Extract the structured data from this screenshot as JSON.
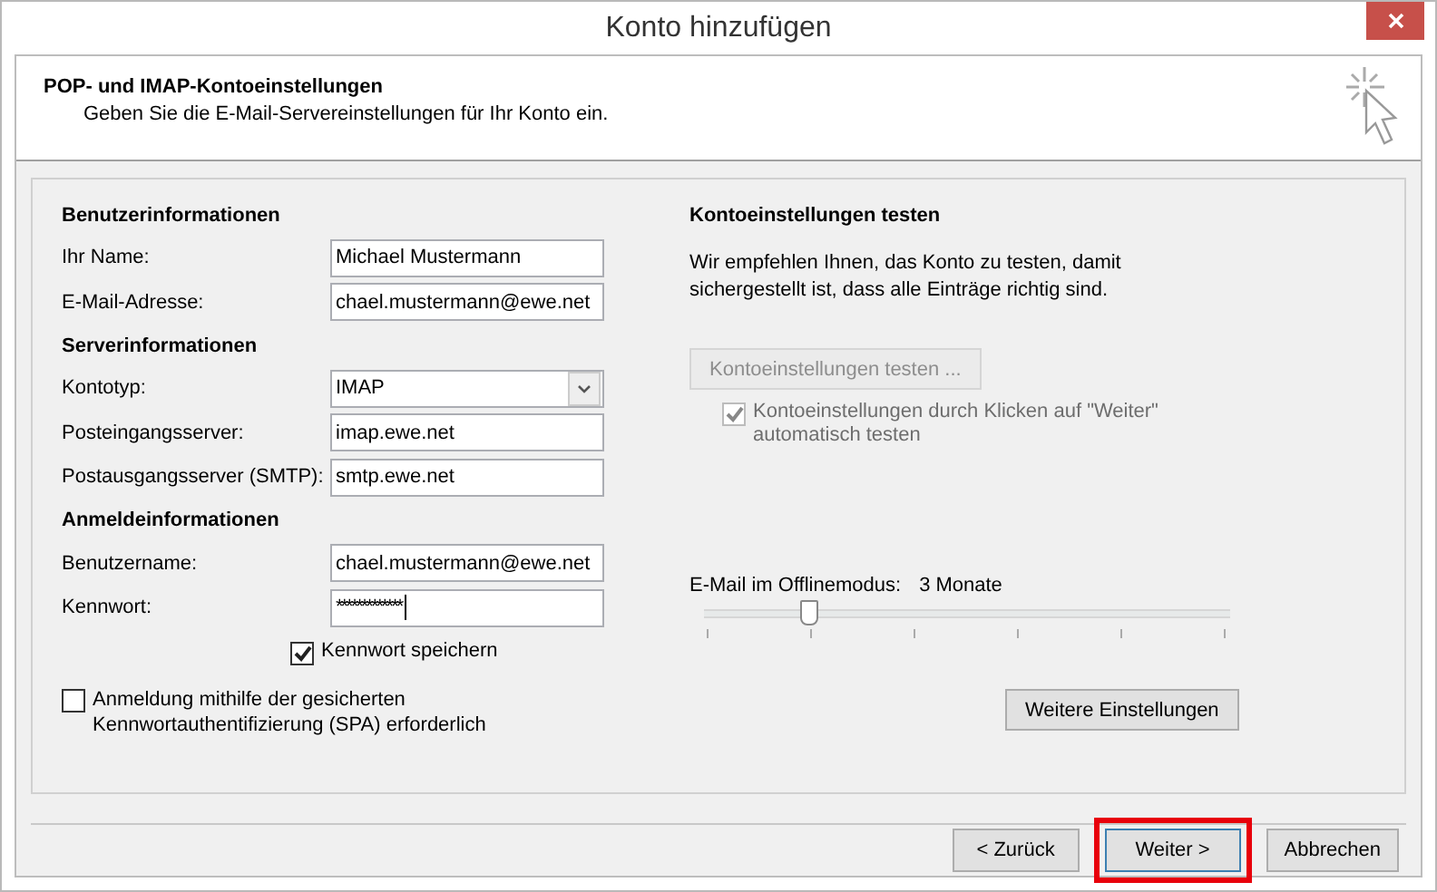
{
  "window": {
    "title": "Konto hinzufügen"
  },
  "header": {
    "title": "POP- und IMAP-Kontoeinstellungen",
    "subtitle": "Geben Sie die E-Mail-Servereinstellungen für Ihr Konto ein."
  },
  "left_sections": [
    {
      "heading": "Benutzerinformationen",
      "fields": [
        {
          "label": "Ihr Name:",
          "kind": "text",
          "value": "Michael Mustermann"
        },
        {
          "label": "E-Mail-Adresse:",
          "kind": "text",
          "value": "chael.mustermann@ewe.net"
        }
      ]
    },
    {
      "heading": "Serverinformationen",
      "fields": [
        {
          "label": "Kontotyp:",
          "kind": "select",
          "value": "IMAP"
        },
        {
          "label": "Posteingangsserver:",
          "kind": "text",
          "value": "imap.ewe.net"
        },
        {
          "label": "Postausgangsserver (SMTP):",
          "kind": "text",
          "value": "smtp.ewe.net"
        }
      ]
    },
    {
      "heading": "Anmeldeinformationen",
      "fields": [
        {
          "label": "Benutzername:",
          "kind": "text",
          "value": "chael.mustermann@ewe.net"
        },
        {
          "label": "Kennwort:",
          "kind": "password",
          "value": "*************"
        }
      ]
    }
  ],
  "save_password": {
    "label": "Kennwort speichern",
    "checked": true
  },
  "spa": {
    "label": "Anmeldung mithilfe der gesicherten Kennwortauthentifizierung (SPA) erforderlich",
    "checked": false
  },
  "test": {
    "heading": "Kontoeinstellungen testen",
    "description": "Wir empfehlen Ihnen, das Konto zu testen, damit sichergestellt ist, dass alle Einträge richtig sind.",
    "button": {
      "label": "Kontoeinstellungen testen ...",
      "disabled": true
    },
    "auto_test": {
      "label": "Kontoeinstellungen durch Klicken auf \"Weiter\" automatisch testen",
      "checked": true,
      "disabled": true
    }
  },
  "offline": {
    "label": "E-Mail im Offlinemodus:",
    "reading": "3 Monate",
    "level": 0.2
  },
  "more_button": {
    "label": "Weitere Einstellungen"
  },
  "buttons": [
    {
      "label": "< Zurück",
      "highlighted": false
    },
    {
      "label": "Weiter >",
      "highlighted": true
    },
    {
      "label": "Abbrechen",
      "highlighted": false
    }
  ]
}
